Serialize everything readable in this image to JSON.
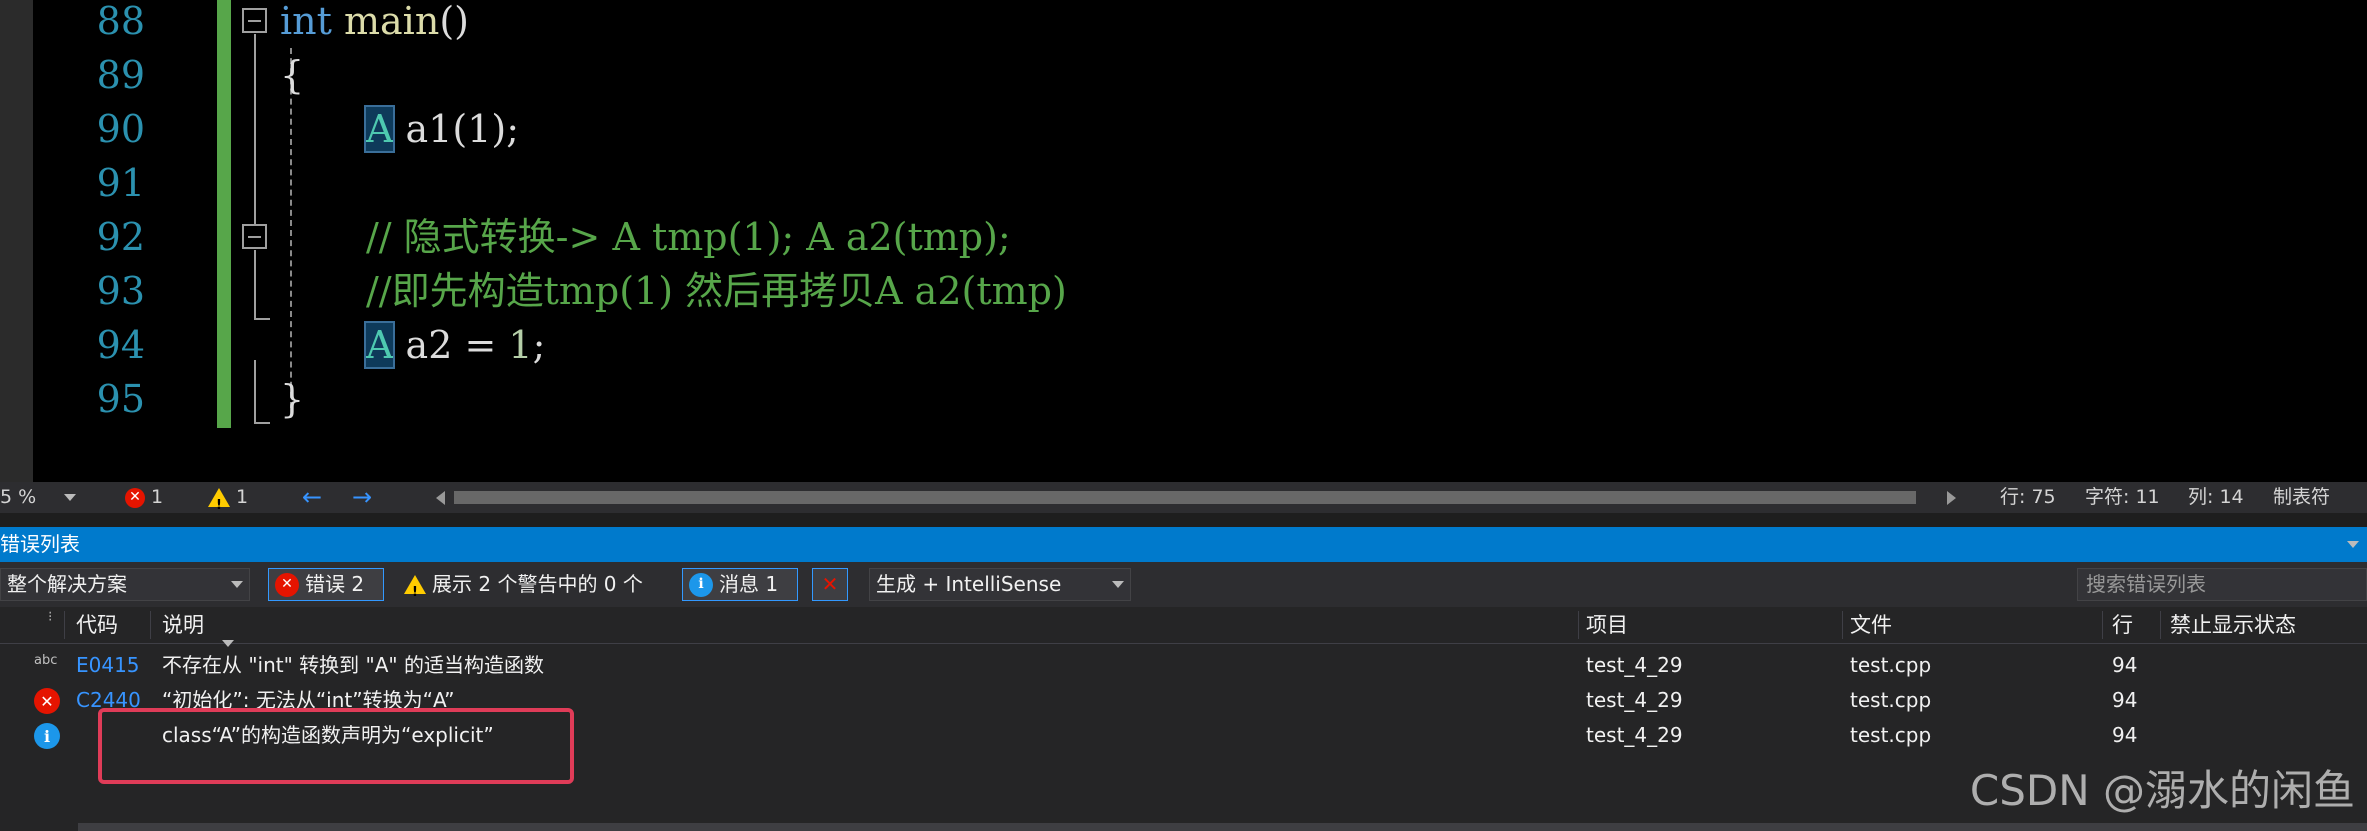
{
  "editor": {
    "line_numbers": [
      "88",
      "89",
      "90",
      "91",
      "92",
      "93",
      "94",
      "95"
    ],
    "lines": {
      "l88_kw": "int",
      "l88_fn": " main",
      "l88_rest": "()",
      "l89": "{",
      "l90_type": "A",
      "l90_rest": " a1(1);",
      "l92": "// 隐式转换-> A tmp(1); A a2(tmp);",
      "l93": "//即先构造tmp(1) 然后再拷贝A a2(tmp)",
      "l94_type": "A",
      "l94_mid": " a2 = ",
      "l94_num": "1",
      "l94_end": ";",
      "l95": "}"
    }
  },
  "status": {
    "zoom": "5 %",
    "error_count": "1",
    "warning_count": "1",
    "row": "行: 75",
    "char": "字符: 11",
    "col": "列: 14",
    "tab_mode": "制表符"
  },
  "panel": {
    "title": "错误列表",
    "scope": "整个解决方案",
    "errors_label": "错误 2",
    "warnings_label": "展示 2 个警告中的 0 个",
    "messages_label": "消息 1",
    "source": "生成 + IntelliSense",
    "search_placeholder": "搜索错误列表"
  },
  "grid": {
    "headers": {
      "code": "代码",
      "desc": "说明",
      "project": "项目",
      "file": "文件",
      "line": "行",
      "suppress": "禁止显示状态"
    },
    "rows": [
      {
        "icon": "abc",
        "code": "E0415",
        "desc": "不存在从 \"int\" 转换到 \"A\" 的适当构造函数",
        "project": "test_4_29",
        "file": "test.cpp",
        "line": "94"
      },
      {
        "icon": "error",
        "code": "C2440",
        "desc": "“初始化”: 无法从“int”转换为“A”",
        "project": "test_4_29",
        "file": "test.cpp",
        "line": "94"
      },
      {
        "icon": "info",
        "code": "",
        "desc": "class“A”的构造函数声明为“explicit”",
        "project": "test_4_29",
        "file": "test.cpp",
        "line": "94"
      }
    ]
  },
  "watermark": "CSDN @溺水的闲鱼",
  "colors": {
    "accent": "#007acc",
    "error": "#e51400",
    "warning": "#ffcc00",
    "info": "#1c97ea",
    "highlight": "#e03c58",
    "comment": "#57a64a"
  }
}
